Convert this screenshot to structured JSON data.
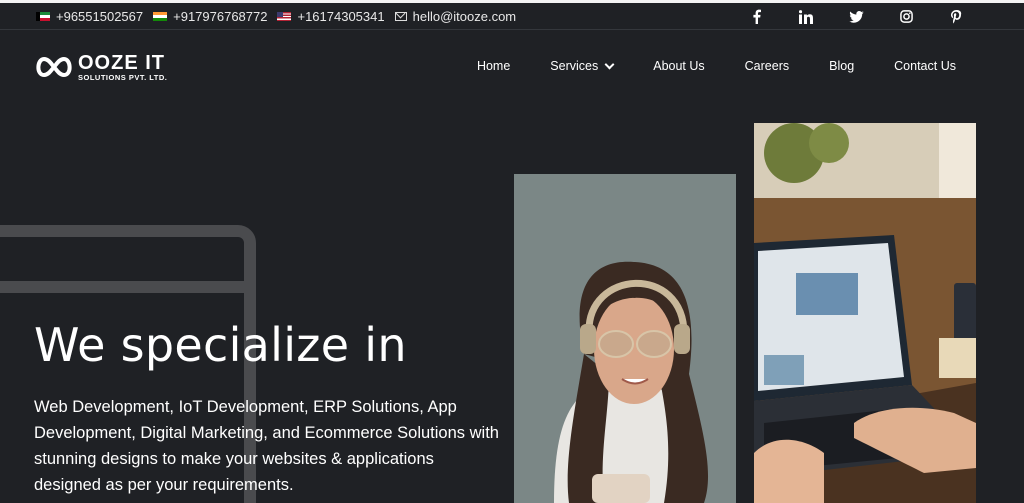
{
  "topbar": {
    "contacts": [
      {
        "flag": "kuwait-flag",
        "text": "+96551502567"
      },
      {
        "flag": "india-flag",
        "text": "+917976768772"
      },
      {
        "flag": "usa-flag",
        "text": "+16174305341"
      }
    ],
    "email": "hello@itooze.com",
    "socials": [
      "facebook-icon",
      "linkedin-icon",
      "twitter-icon",
      "instagram-icon",
      "pinterest-icon"
    ]
  },
  "logo": {
    "main": "OOZE IT",
    "sub": "SOLUTIONS PVT. LTD."
  },
  "nav": {
    "items": [
      "Home",
      "Services",
      "About Us",
      "Careers",
      "Blog",
      "Contact Us"
    ]
  },
  "hero": {
    "title": "We specialize in",
    "text": "Web Development, IoT Development, ERP Solutions, App Development, Digital Marketing, and Ecommerce Solutions with stunning designs to make your websites & applications designed as per your requirements."
  },
  "colors": {
    "background": "#1f2125",
    "text": "#ffffff",
    "deco": "#4a4b4e"
  }
}
